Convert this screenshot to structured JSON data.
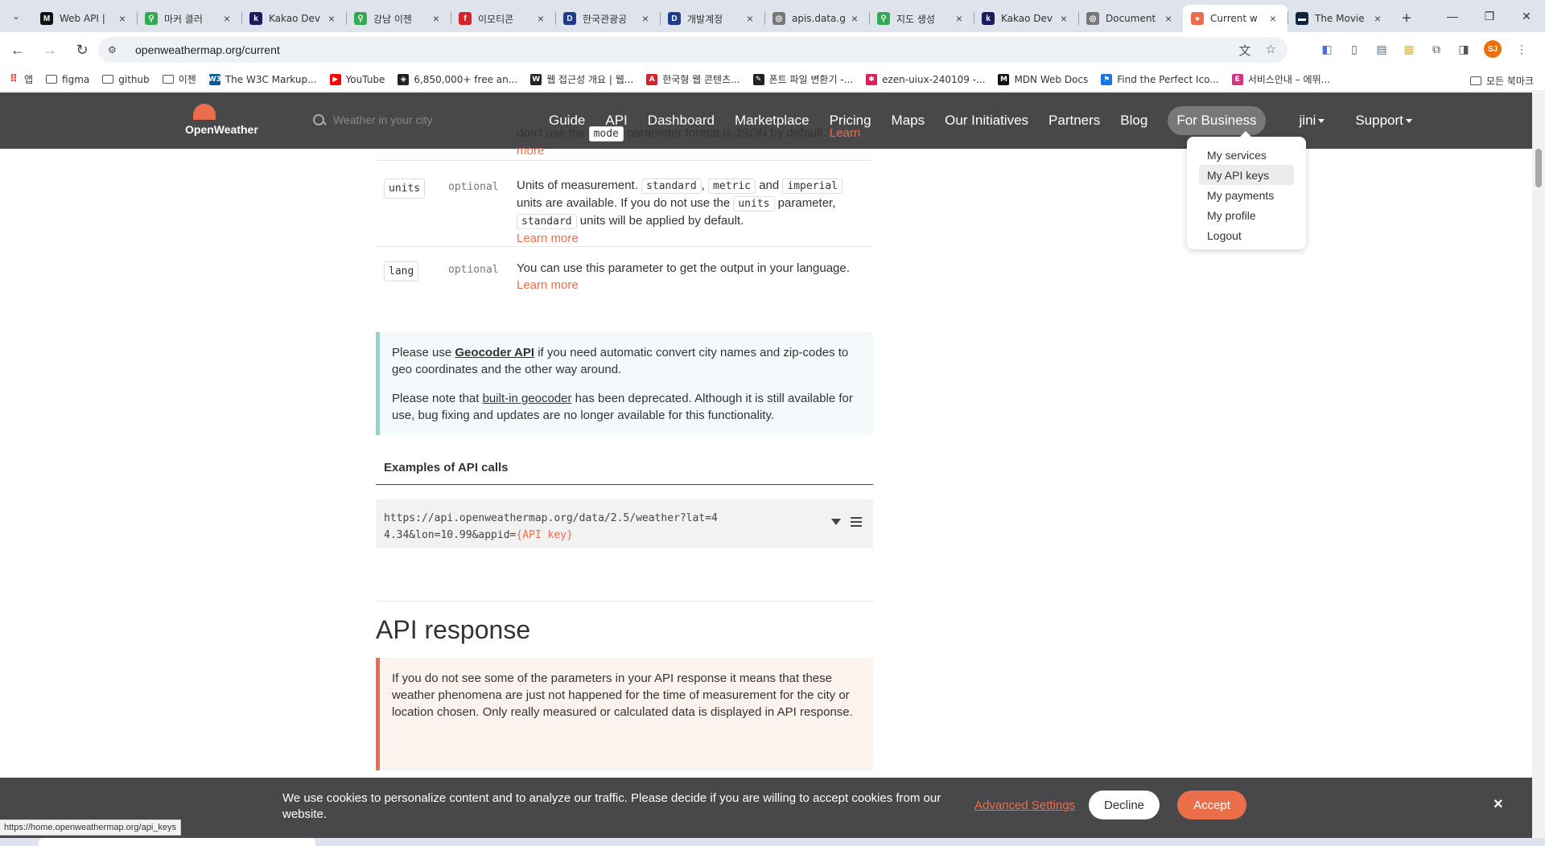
{
  "browser": {
    "tabs": [
      {
        "title": "Web API |",
        "fav_color": "#111111",
        "fav_glyph": "M"
      },
      {
        "title": "마커 클러",
        "fav_color": "#34a853",
        "fav_glyph": "⚲"
      },
      {
        "title": "Kakao Dev",
        "fav_color": "#1a1a5e",
        "fav_glyph": "k"
      },
      {
        "title": "강남 이젠",
        "fav_color": "#34a853",
        "fav_glyph": "⚲"
      },
      {
        "title": "이모티콘",
        "fav_color": "#d4242b",
        "fav_glyph": "f"
      },
      {
        "title": "한국관광공",
        "fav_color": "#1f3b8a",
        "fav_glyph": "D"
      },
      {
        "title": "개발계정",
        "fav_color": "#1f3b8a",
        "fav_glyph": "D"
      },
      {
        "title": "apis.data.g",
        "fav_color": "#777777",
        "fav_glyph": "◎"
      },
      {
        "title": "지도 생성",
        "fav_color": "#34a853",
        "fav_glyph": "⚲"
      },
      {
        "title": "Kakao Dev",
        "fav_color": "#1a1a5e",
        "fav_glyph": "k"
      },
      {
        "title": "Document",
        "fav_color": "#777777",
        "fav_glyph": "◎"
      },
      {
        "title": "Current w",
        "fav_color": "#eb6e4b",
        "fav_glyph": "●"
      },
      {
        "title": "The Movie",
        "fav_color": "#0d253f",
        "fav_glyph": "▬"
      }
    ],
    "active_tab_index": 11,
    "url": "openweathermap.org/current",
    "profile_initials": "SJ",
    "bookmarks": [
      {
        "label": "앱",
        "type": "apps"
      },
      {
        "label": "figma",
        "type": "folder"
      },
      {
        "label": "github",
        "type": "folder"
      },
      {
        "label": "이젠",
        "type": "folder"
      },
      {
        "label": "The W3C Markup...",
        "type": "site",
        "color": "#005a9c",
        "glyph": "W3"
      },
      {
        "label": "YouTube",
        "type": "site",
        "color": "#ff0000",
        "glyph": "▶"
      },
      {
        "label": "6,850,000+ free an...",
        "type": "site",
        "color": "#222222",
        "glyph": "◈"
      },
      {
        "label": "웹 접근성 개요 | 웹...",
        "type": "site",
        "color": "#222222",
        "glyph": "W"
      },
      {
        "label": "한국형 웹 콘텐츠...",
        "type": "site",
        "color": "#d4242b",
        "glyph": "A"
      },
      {
        "label": "폰트 파일 변환기 -...",
        "type": "site",
        "color": "#222222",
        "glyph": "✎"
      },
      {
        "label": "ezen-uiux-240109 -...",
        "type": "site",
        "color": "#e01e5a",
        "glyph": "✱"
      },
      {
        "label": "MDN Web Docs",
        "type": "site",
        "color": "#111111",
        "glyph": "M"
      },
      {
        "label": "Find the Perfect Ico...",
        "type": "site",
        "color": "#1a73e8",
        "glyph": "⚑"
      },
      {
        "label": "서비스안내 – 에뛰...",
        "type": "site",
        "color": "#d63384",
        "glyph": "E"
      }
    ],
    "bookmarks_all": "모든 북마크",
    "status_url": "https://home.openweathermap.org/api_keys"
  },
  "site": {
    "logo_text": "OpenWeather",
    "search_placeholder": "Weather in your city",
    "nav": [
      "Guide",
      "API",
      "Dashboard",
      "Marketplace",
      "Pricing",
      "Maps",
      "Our Initiatives",
      "Partners",
      "Blog"
    ],
    "for_business": "For Business",
    "user": "jini",
    "support": "Support",
    "user_menu": [
      "My services",
      "My API keys",
      "My payments",
      "My profile",
      "Logout"
    ],
    "user_menu_hover_index": 1
  },
  "content": {
    "mode_row": {
      "text_a": "don't use the",
      "code": "mode",
      "text_b": "parameter format is JSON by default.",
      "link": "Learn more"
    },
    "units_row": {
      "name": "units",
      "optional": "optional",
      "t1": "Units of measurement.",
      "c1": "standard",
      "t2": ",",
      "c2": "metric",
      "t3": "and",
      "c3": "imperial",
      "t4": "units are available. If you do not use the",
      "c4": "units",
      "t5": "parameter,",
      "c5": "standard",
      "t6": "units will be applied by default.",
      "link": "Learn more"
    },
    "lang_row": {
      "name": "lang",
      "optional": "optional",
      "text": "You can use this parameter to get the output in your language.",
      "link": "Learn more"
    },
    "info": {
      "p1_a": "Please use",
      "p1_link": "Geocoder API",
      "p1_b": "if you need automatic convert city names and zip-codes to geo coordinates and the other way around.",
      "p2_a": "Please note that",
      "p2_link": "built-in geocoder",
      "p2_b": "has been deprecated. Although it is still available for use, bug fixing and updates are no longer available for this functionality."
    },
    "examples_title": "Examples of API calls",
    "example_url": "https://api.openweathermap.org/data/2.5/weather?lat=44.34&lon=10.99&appid=",
    "example_key": "{API key}",
    "api_response_title": "API response",
    "warn_text": "If you do not see some of the parameters in your API response it means that these weather phenomena are just not happened for the time of measurement for the city or location chosen. Only really measured or calculated data is displayed in API response."
  },
  "cookie": {
    "text": "We use cookies to personalize content and to analyze our traffic. Please decide if you are willing to accept cookies from our website.",
    "advanced": "Advanced Settings",
    "decline": "Decline",
    "accept": "Accept",
    "close": "×"
  },
  "colors": {
    "accent": "#eb6e4b",
    "header_bg": "#48484a"
  }
}
